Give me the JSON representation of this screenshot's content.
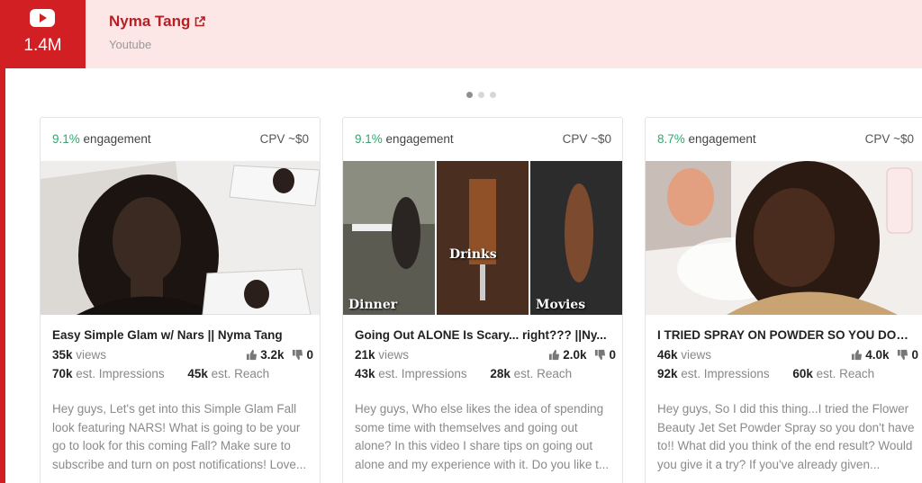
{
  "header": {
    "follower_count": "1.4M",
    "creator_name": "Nyma Tang",
    "platform": "Youtube"
  },
  "carousel": {
    "dots": 3,
    "active_index": 0
  },
  "cards": [
    {
      "engagement_pct": "9.1%",
      "engagement_label": "engagement",
      "cpv": "CPV ~$0",
      "title": "Easy Simple Glam w/ Nars || Nyma Tang",
      "views": "35k",
      "views_label": "views",
      "likes": "3.2k",
      "dislikes": "0",
      "impressions": "70k",
      "impressions_label": "est. Impressions",
      "reach": "45k",
      "reach_label": "est. Reach",
      "description": "Hey guys, Let's get into this Simple Glam Fall look featuring NARS! What is going to be your go to look for this coming Fall? Make sure to subscribe and turn on post notifications! Love..."
    },
    {
      "engagement_pct": "9.1%",
      "engagement_label": "engagement",
      "cpv": "CPV ~$0",
      "title": "Going Out ALONE Is Scary... right??? ||Ny...",
      "views": "21k",
      "views_label": "views",
      "likes": "2.0k",
      "dislikes": "0",
      "impressions": "43k",
      "impressions_label": "est. Impressions",
      "reach": "28k",
      "reach_label": "est. Reach",
      "thumb_words": [
        "Dinner",
        "Drinks",
        "Movies"
      ],
      "description": "Hey guys, Who else likes the idea of spending some time with themselves and going out alone? In this video I share tips on going out alone and my experience with it. Do you like t..."
    },
    {
      "engagement_pct": "8.7%",
      "engagement_label": "engagement",
      "cpv": "CPV ~$0",
      "title": "I TRIED SPRAY ON POWDER SO YOU DON'...",
      "views": "46k",
      "views_label": "views",
      "likes": "4.0k",
      "dislikes": "0",
      "impressions": "92k",
      "impressions_label": "est. Impressions",
      "reach": "60k",
      "reach_label": "est. Reach",
      "description": "Hey guys, So I did this thing...I tried the Flower Beauty Jet Set Powder Spray so you don't have to!! What did you think of the end result? Would you give it a try? If you've already given..."
    }
  ],
  "colors": {
    "brand_red": "#d11f23",
    "header_bg": "#fce6e6",
    "engagement_green": "#38a56f"
  },
  "icons": [
    "youtube-icon",
    "external-link-icon",
    "thumbs-up-icon",
    "thumbs-down-icon"
  ]
}
